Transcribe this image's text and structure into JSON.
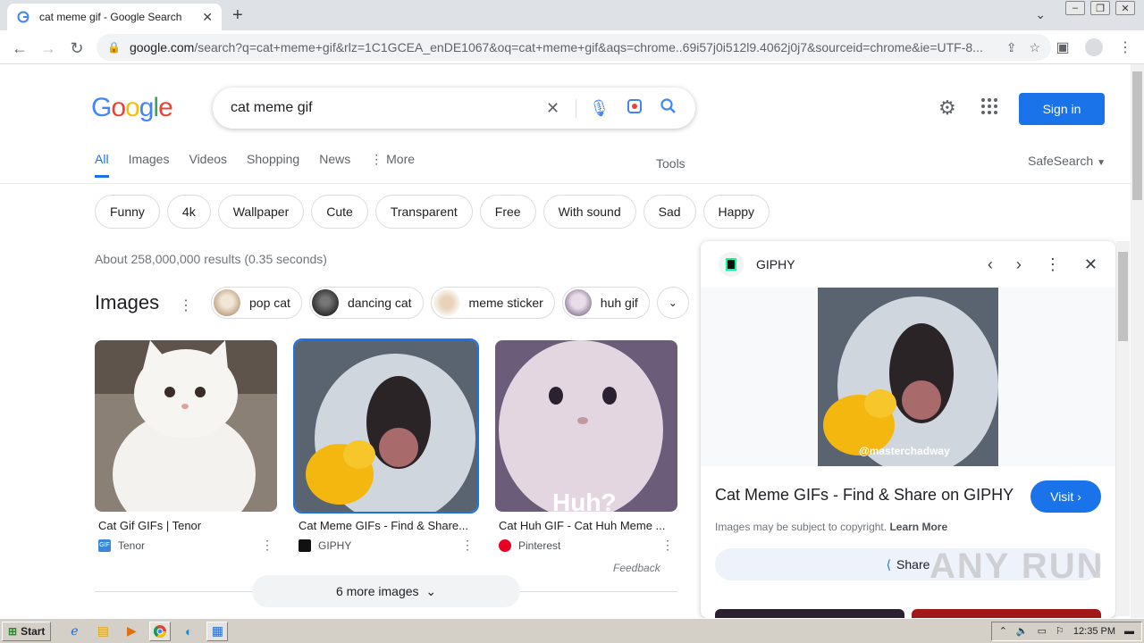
{
  "browser": {
    "tab_title": "cat meme gif - Google Search",
    "url_host": "google.com",
    "url_path": "/search?q=cat+meme+gif&rlz=1C1GCEA_enDE1067&oq=cat+meme+gif&aqs=chrome..69i57j0i512l9.4062j0j7&sourceid=chrome&ie=UTF-8..."
  },
  "google": {
    "logo": "Google",
    "query": "cat meme gif",
    "signin": "Sign in",
    "tabs": [
      "All",
      "Images",
      "Videos",
      "Shopping",
      "News",
      "⋮ More"
    ],
    "tools": "Tools",
    "safesearch": "SafeSearch",
    "chips": [
      "Funny",
      "4k",
      "Wallpaper",
      "Cute",
      "Transparent",
      "Free",
      "With sound",
      "Sad",
      "Happy"
    ],
    "stats": "About 258,000,000 results (0.35 seconds)",
    "images_heading": "Images",
    "suggestions": [
      "pop cat",
      "dancing cat",
      "meme sticker",
      "huh gif"
    ],
    "results": [
      {
        "caption": "Cat Gif GIFs | Tenor",
        "source": "Tenor"
      },
      {
        "caption": "Cat Meme GIFs - Find & Share...",
        "source": "GIPHY"
      },
      {
        "caption": "Cat Huh GIF - Cat Huh Meme ...",
        "source": "Pinterest"
      }
    ],
    "huh_overlay": "Huh?",
    "feedback": "Feedback",
    "more_images": "6 more images"
  },
  "panel": {
    "site": "GIPHY",
    "watermark": "@masterchadway",
    "title": "Cat Meme GIFs - Find & Share on GIPHY",
    "visit": "Visit",
    "copyright": "Images may be subject to copyright.",
    "learn_more": "Learn More",
    "share": "Share"
  },
  "taskbar": {
    "start": "Start",
    "clock": "12:35 PM"
  },
  "overlay": {
    "watermark": "ANY RUN"
  },
  "colors": {
    "accent": "#1a73e8",
    "logo_blue": "#4285f4",
    "logo_red": "#ea4335",
    "logo_yellow": "#fbbc05",
    "logo_green": "#34a853"
  }
}
